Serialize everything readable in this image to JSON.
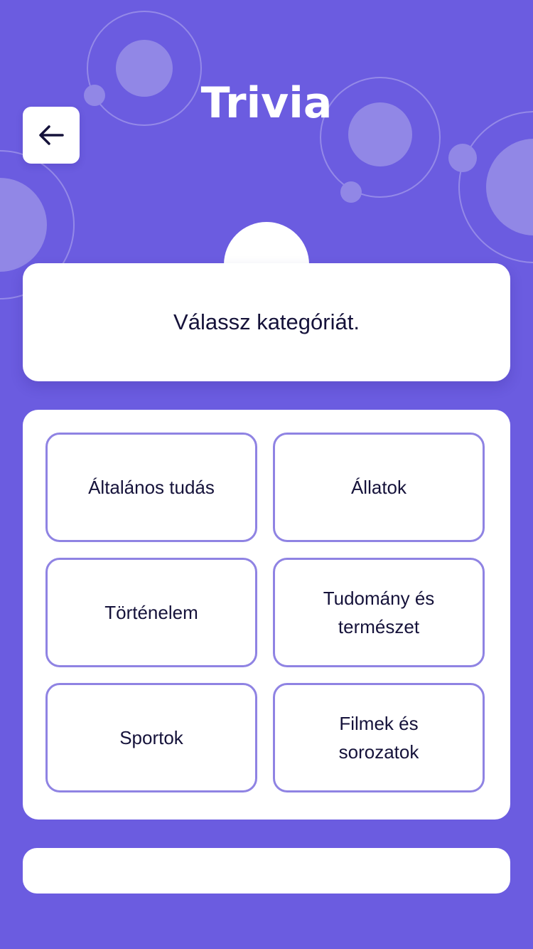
{
  "colors": {
    "background": "#6b5ce0",
    "card": "#ffffff",
    "option_border": "#8f83e3",
    "text": "#15123a",
    "decor_fill": "#9187e6"
  },
  "header": {
    "title": "Trivia",
    "back_icon": "arrow-left-icon"
  },
  "question": {
    "text": "Válassz kategóriát."
  },
  "categories": [
    {
      "label": "Általános tudás"
    },
    {
      "label": "Állatok"
    },
    {
      "label": "Történelem"
    },
    {
      "label": "Tudomány és természet"
    },
    {
      "label": "Sportok"
    },
    {
      "label": "Filmek és sorozatok"
    }
  ],
  "progress": {
    "value": 0
  }
}
